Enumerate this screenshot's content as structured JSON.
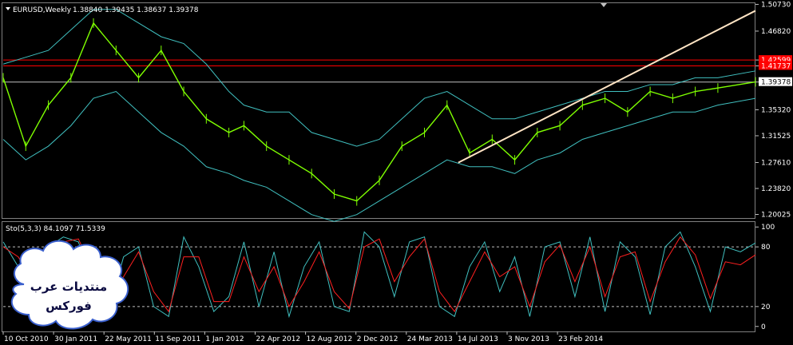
{
  "chart_data": [
    {
      "type": "line",
      "name": "price-panel",
      "title": "EURUSD,Weekly",
      "ohlc_readout": "1.38840 1.39435 1.38637 1.39378",
      "ylim": [
        1.195,
        1.509
      ],
      "y_ticks": [
        "1.50730",
        "1.46820",
        "1.42599",
        "1.41737",
        "1.39378",
        "1.35320",
        "1.31525",
        "1.27610",
        "1.23820",
        "1.20025"
      ],
      "y_tick_values": [
        1.5073,
        1.4682,
        1.42599,
        1.41737,
        1.39378,
        1.3532,
        1.31525,
        1.2761,
        1.2382,
        1.20025
      ],
      "x_labels": [
        "10 Oct 2010",
        "30 Jan 2011",
        "22 May 2011",
        "11 Sep 2011",
        "1 Jan 2012",
        "22 Apr 2012",
        "12 Aug 2012",
        "2 Dec 2012",
        "24 Mar 2013",
        "14 Jul 2013",
        "3 Nov 2013",
        "23 Feb 2014"
      ],
      "horizontal_levels": [
        {
          "value": 1.42599,
          "label": "1.42599",
          "color": "#ff0000"
        },
        {
          "value": 1.41737,
          "label": "1.41737",
          "color": "#ff0000"
        },
        {
          "value": 1.39378,
          "label": "1.39378",
          "color": "#c0c0c0"
        }
      ],
      "trendline": {
        "from": {
          "x": 60.5,
          "y": 1.276
        },
        "to": {
          "x": 100,
          "y": 1.498
        },
        "color": "#ffe4c4"
      },
      "series": [
        {
          "role": "close",
          "color": "#7fff00",
          "x": [
            0,
            3,
            6,
            9,
            12,
            15,
            18,
            21,
            24,
            27,
            30,
            32,
            35,
            38,
            41,
            44,
            47,
            50,
            53,
            56,
            59,
            62,
            65,
            68,
            71,
            74,
            77,
            80,
            83,
            86,
            89,
            92,
            95,
            100
          ],
          "y": [
            1.4,
            1.3,
            1.36,
            1.4,
            1.48,
            1.44,
            1.4,
            1.44,
            1.38,
            1.34,
            1.32,
            1.33,
            1.3,
            1.28,
            1.26,
            1.23,
            1.22,
            1.25,
            1.3,
            1.32,
            1.36,
            1.29,
            1.31,
            1.28,
            1.32,
            1.33,
            1.36,
            1.37,
            1.35,
            1.38,
            1.37,
            1.38,
            1.385,
            1.394
          ]
        },
        {
          "role": "upper-band",
          "color": "#40c0c0",
          "x": [
            0,
            3,
            6,
            9,
            12,
            15,
            18,
            21,
            24,
            27,
            30,
            32,
            35,
            38,
            41,
            44,
            47,
            50,
            53,
            56,
            59,
            62,
            65,
            68,
            71,
            74,
            77,
            80,
            83,
            86,
            89,
            92,
            95,
            100
          ],
          "y": [
            1.42,
            1.43,
            1.44,
            1.47,
            1.5,
            1.5,
            1.48,
            1.46,
            1.45,
            1.42,
            1.38,
            1.36,
            1.35,
            1.35,
            1.32,
            1.31,
            1.3,
            1.31,
            1.34,
            1.37,
            1.38,
            1.36,
            1.34,
            1.34,
            1.35,
            1.36,
            1.37,
            1.38,
            1.38,
            1.39,
            1.39,
            1.4,
            1.4,
            1.41
          ]
        },
        {
          "role": "lower-band",
          "color": "#40c0c0",
          "x": [
            0,
            3,
            6,
            9,
            12,
            15,
            18,
            21,
            24,
            27,
            30,
            32,
            35,
            38,
            41,
            44,
            47,
            50,
            53,
            56,
            59,
            62,
            65,
            68,
            71,
            74,
            77,
            80,
            83,
            86,
            89,
            92,
            95,
            100
          ],
          "y": [
            1.31,
            1.28,
            1.3,
            1.33,
            1.37,
            1.38,
            1.35,
            1.32,
            1.3,
            1.27,
            1.26,
            1.25,
            1.24,
            1.22,
            1.2,
            1.19,
            1.2,
            1.22,
            1.24,
            1.26,
            1.28,
            1.27,
            1.27,
            1.26,
            1.28,
            1.29,
            1.31,
            1.32,
            1.33,
            1.34,
            1.35,
            1.35,
            1.36,
            1.37
          ]
        }
      ]
    },
    {
      "type": "line",
      "name": "stochastic-panel",
      "title": "Sto(5,3,3) 84.1097 71.5339",
      "ylim": [
        -5,
        105
      ],
      "y_ticks": [
        "100",
        "80",
        "20",
        "0"
      ],
      "y_tick_values": [
        100,
        80,
        20,
        0
      ],
      "levels": [
        80,
        20
      ],
      "series": [
        {
          "role": "main",
          "color": "#40c0c0",
          "x": [
            0,
            2,
            4,
            6,
            8,
            10,
            12,
            14,
            16,
            18,
            20,
            22,
            24,
            26,
            28,
            30,
            32,
            34,
            36,
            38,
            40,
            42,
            44,
            46,
            48,
            50,
            52,
            54,
            56,
            58,
            60,
            62,
            64,
            66,
            68,
            70,
            72,
            74,
            76,
            78,
            80,
            82,
            84,
            86,
            88,
            90,
            92,
            94,
            96,
            98,
            100
          ],
          "y": [
            85,
            60,
            35,
            80,
            90,
            85,
            40,
            15,
            70,
            80,
            20,
            10,
            90,
            60,
            15,
            30,
            85,
            20,
            75,
            10,
            60,
            85,
            20,
            15,
            95,
            80,
            30,
            85,
            90,
            20,
            10,
            60,
            85,
            35,
            70,
            10,
            80,
            85,
            30,
            90,
            15,
            85,
            70,
            12,
            80,
            95,
            60,
            15,
            80,
            75,
            84
          ]
        },
        {
          "role": "signal",
          "color": "#ff2020",
          "x": [
            0,
            2,
            4,
            6,
            8,
            10,
            12,
            14,
            16,
            18,
            20,
            22,
            24,
            26,
            28,
            30,
            32,
            34,
            36,
            38,
            40,
            42,
            44,
            46,
            48,
            50,
            52,
            54,
            56,
            58,
            60,
            62,
            64,
            66,
            68,
            70,
            72,
            74,
            76,
            78,
            80,
            82,
            84,
            86,
            88,
            90,
            92,
            94,
            96,
            98,
            100
          ],
          "y": [
            80,
            70,
            45,
            65,
            85,
            88,
            55,
            25,
            50,
            75,
            35,
            15,
            70,
            70,
            25,
            25,
            70,
            35,
            60,
            20,
            45,
            75,
            35,
            18,
            80,
            88,
            45,
            70,
            88,
            35,
            15,
            45,
            75,
            50,
            60,
            20,
            65,
            82,
            45,
            80,
            30,
            70,
            75,
            25,
            65,
            90,
            72,
            28,
            65,
            62,
            72
          ]
        }
      ]
    }
  ],
  "watermark": {
    "line1": "منتديات عرب",
    "line2": "فوركس"
  }
}
